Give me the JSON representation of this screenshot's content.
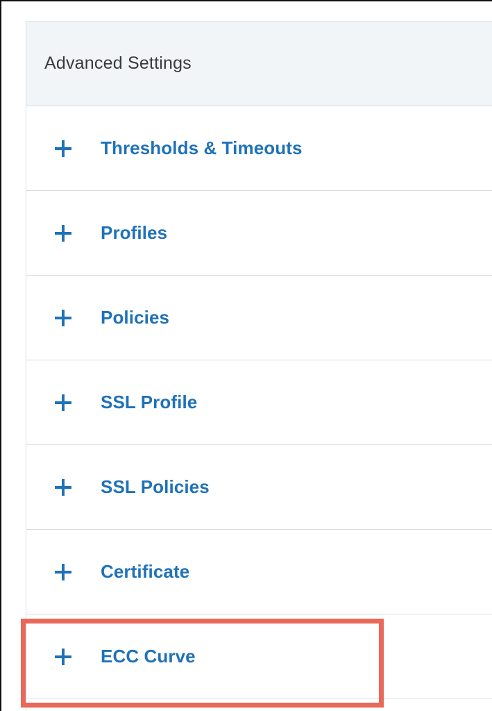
{
  "panel": {
    "title": "Advanced Settings",
    "items": [
      {
        "label": "Thresholds & Timeouts",
        "icon": "plus-icon"
      },
      {
        "label": "Profiles",
        "icon": "plus-icon"
      },
      {
        "label": "Policies",
        "icon": "plus-icon"
      },
      {
        "label": "SSL Profile",
        "icon": "plus-icon"
      },
      {
        "label": "SSL Policies",
        "icon": "plus-icon"
      },
      {
        "label": "Certificate",
        "icon": "plus-icon"
      },
      {
        "label": "ECC Curve",
        "icon": "plus-icon"
      }
    ]
  },
  "colors": {
    "link": "#1f72b8",
    "header_bg": "#f1f5f8",
    "highlight": "#e8685a"
  }
}
